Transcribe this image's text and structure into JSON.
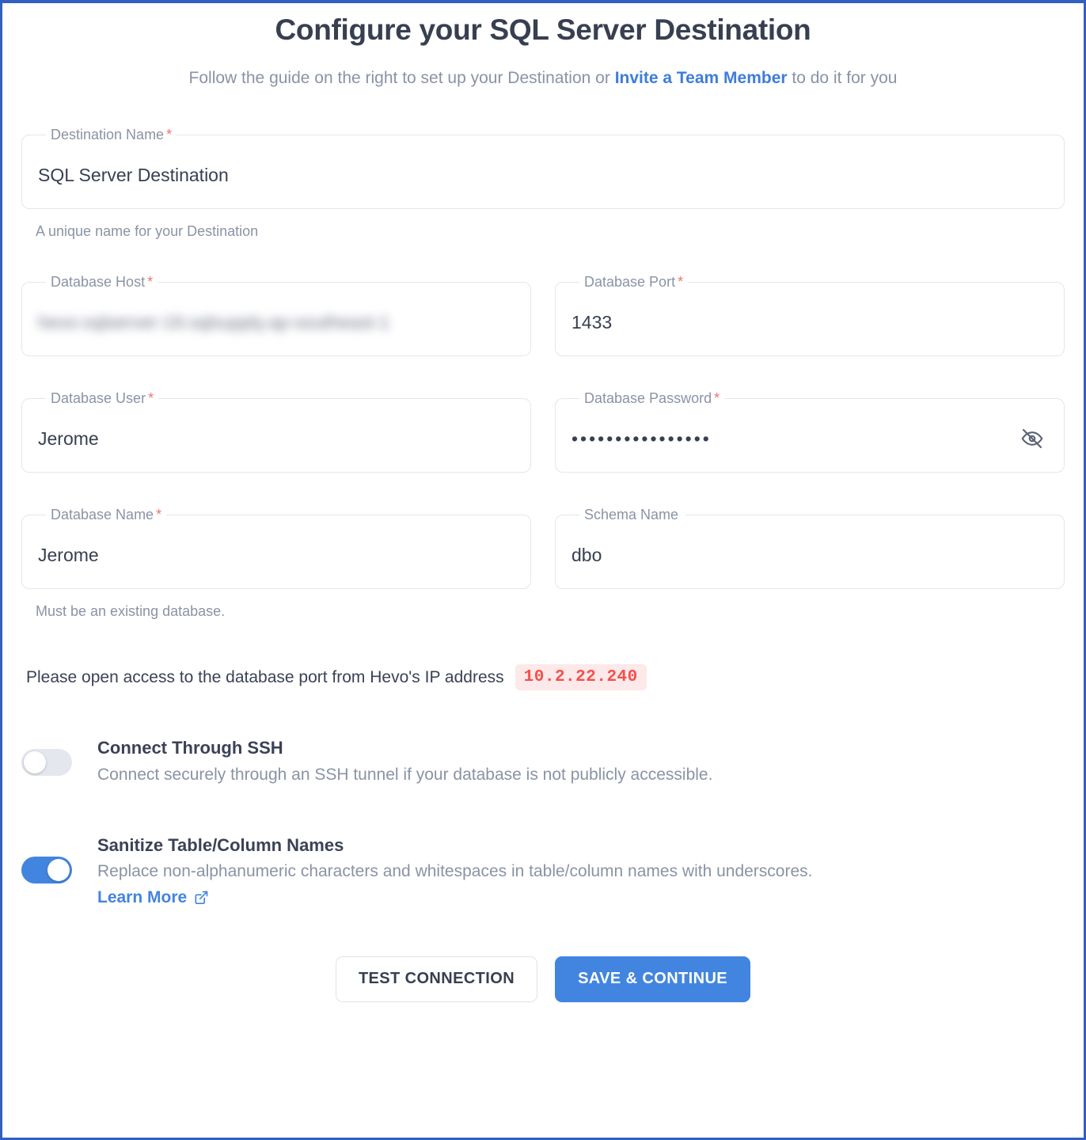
{
  "header": {
    "title": "Configure your SQL Server Destination",
    "subtitle_before": "Follow the guide on the right to set up your Destination or ",
    "subtitle_link": "Invite a Team Member",
    "subtitle_after": " to do it for you"
  },
  "form": {
    "destination_name": {
      "label": "Destination Name",
      "required_mark": "*",
      "value": "SQL Server Destination",
      "helper": "A unique name for your Destination"
    },
    "database_host": {
      "label": "Database Host",
      "required_mark": "*",
      "value": "hevo-sqlserver-19.sqlsupply.ap-southeast-1",
      "redacted": true
    },
    "database_port": {
      "label": "Database Port",
      "required_mark": "*",
      "value": "1433"
    },
    "database_user": {
      "label": "Database User",
      "required_mark": "*",
      "value": "Jerome"
    },
    "database_password": {
      "label": "Database Password",
      "required_mark": "*",
      "value": "••••••••••••••••",
      "toggle_icon": "eye-off-icon"
    },
    "database_name": {
      "label": "Database Name",
      "required_mark": "*",
      "value": "Jerome",
      "helper": "Must be an existing database."
    },
    "schema_name": {
      "label": "Schema Name",
      "required_mark": "",
      "value": "dbo"
    }
  },
  "ip_notice": {
    "text": "Please open access to the database port from Hevo's IP address",
    "ip": "10.2.22.240"
  },
  "toggles": [
    {
      "name": "connect-through-ssh",
      "title": "Connect Through SSH",
      "description": "Connect securely through an SSH tunnel if your database is not publicly accessible.",
      "enabled": false
    },
    {
      "name": "sanitize-table-column-names",
      "title": "Sanitize Table/Column Names",
      "description": "Replace non-alphanumeric characters and whitespaces in table/column names with underscores.",
      "enabled": true,
      "link_label": "Learn More",
      "link_icon": "external-link-icon"
    }
  ],
  "actions": {
    "test_connection": "TEST CONNECTION",
    "save_continue": "SAVE & CONTINUE"
  },
  "colors": {
    "page_border": "#3160c0",
    "accent_blue": "#4285e0",
    "link_blue": "#3d7ddb",
    "required_red": "#f4736f",
    "ip_text": "#f4504b",
    "ip_bg": "#fde9e9",
    "heading": "#373f50",
    "muted": "#8a93a5"
  }
}
